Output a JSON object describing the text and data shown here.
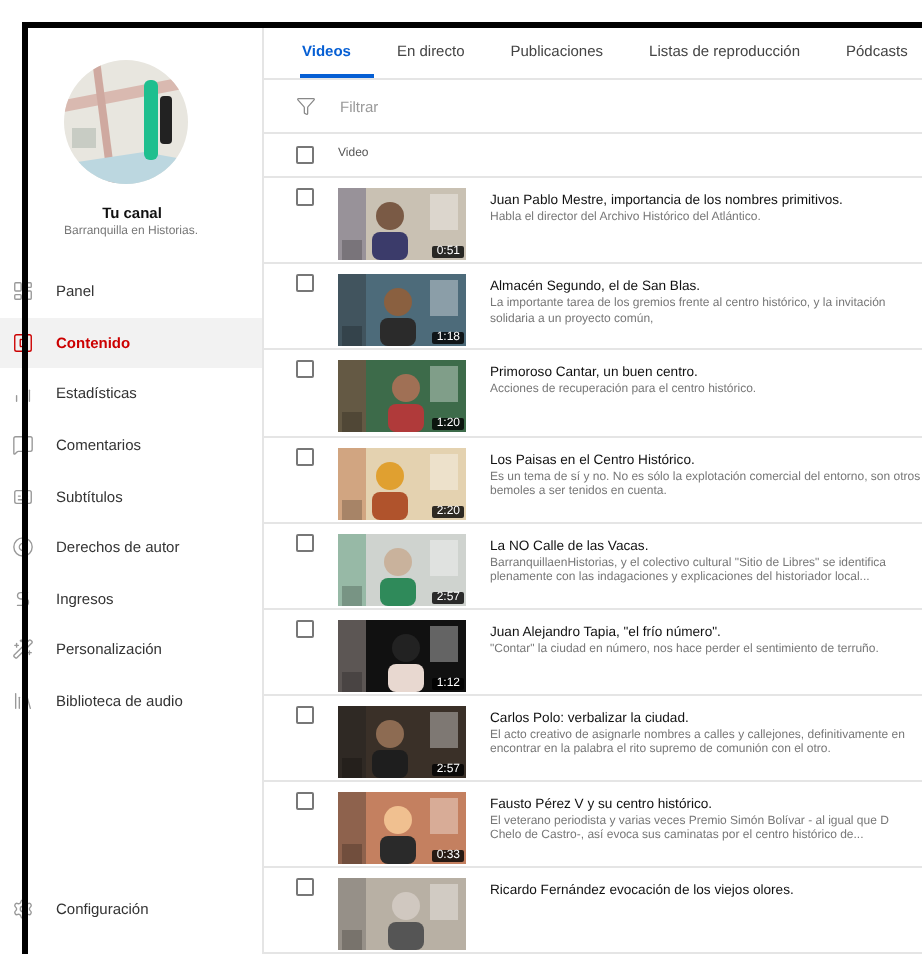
{
  "sidebar": {
    "channel": {
      "label": "Tu canal",
      "name": "Barranquilla en Historias."
    },
    "items": [
      {
        "label": "Panel",
        "selected": false
      },
      {
        "label": "Contenido",
        "selected": true
      },
      {
        "label": "Estadísticas",
        "selected": false
      },
      {
        "label": "Comentarios",
        "selected": false
      },
      {
        "label": "Subtítulos",
        "selected": false
      },
      {
        "label": "Derechos de autor",
        "selected": false
      },
      {
        "label": "Ingresos",
        "selected": false
      },
      {
        "label": "Personalización",
        "selected": false
      },
      {
        "label": "Biblioteca de audio",
        "selected": false
      }
    ],
    "footer_items": [
      {
        "label": "Configuración",
        "selected": false
      }
    ]
  },
  "tabs": [
    {
      "label": "Videos",
      "selected": true
    },
    {
      "label": "En directo",
      "selected": false
    },
    {
      "label": "Publicaciones",
      "selected": false
    },
    {
      "label": "Listas de reproducción",
      "selected": false
    },
    {
      "label": "Pódcasts",
      "selected": false
    }
  ],
  "filter": {
    "placeholder": "Filtrar"
  },
  "table": {
    "header": {
      "label": "Video",
      "checked": false
    },
    "rows": [
      {
        "checked": false,
        "duration": "0:51",
        "title": "Juan Pablo Mestre, importancia de los nombres primitivos.",
        "description": "Habla el director del Archivo Histórico del Atlántico."
      },
      {
        "checked": false,
        "duration": "1:18",
        "title": "Almacén Segundo, el de San Blas.",
        "description": "La importante tarea de los gremios frente al centro histórico, y la invitación solidaria a un proyecto común,"
      },
      {
        "checked": false,
        "duration": "1:20",
        "title": "Primoroso Cantar, un buen centro.",
        "description": "Acciones de recuperación para el centro histórico."
      },
      {
        "checked": false,
        "duration": "2:20",
        "title": "Los Paisas en el Centro Histórico.",
        "description": "Es un tema de sí y no. No es sólo la explotación comercial del entorno, son otros bemoles a ser tenidos en cuenta."
      },
      {
        "checked": false,
        "duration": "2:57",
        "title": "La NO Calle de las Vacas.",
        "description": "BarranquillaenHistorias, y el colectivo cultural \"Sitio de Libres\" se identifica plenamente con las indagaciones y explicaciones del historiador local..."
      },
      {
        "checked": false,
        "duration": "1:12",
        "title": "Juan Alejandro Tapia, \"el frío número\".",
        "description": "\"Contar\" la ciudad en número, nos hace perder el sentimiento de terruño."
      },
      {
        "checked": false,
        "duration": "2:57",
        "title": "Carlos Polo: verbalizar la ciudad.",
        "description": "El acto creativo de asignarle nombres a calles y callejones, definitivamente en encontrar en la palabra el rito supremo de comunión con el otro."
      },
      {
        "checked": false,
        "duration": "0:33",
        "title": "Fausto Pérez V y su centro histórico.",
        "description": "El veterano periodista y varias veces Premio Simón Bolívar - al igual que D Chelo de Castro-, así evoca sus caminatas por el centro histórico de..."
      },
      {
        "checked": false,
        "title": "Ricardo Fernández evocación de los viejos olores."
      }
    ]
  }
}
